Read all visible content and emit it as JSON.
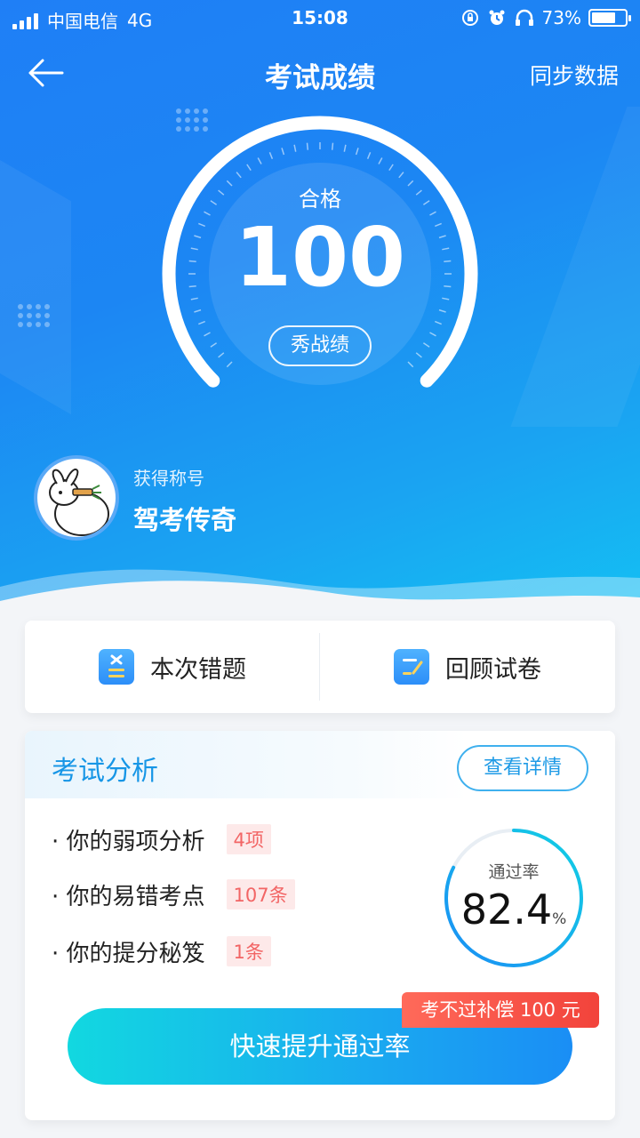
{
  "status_bar": {
    "carrier": "中国电信",
    "network": "4G",
    "time": "15:08",
    "battery": "73%",
    "battery_level": 0.73,
    "icons": [
      "signal-icon",
      "rotation-lock-icon",
      "alarm-icon",
      "headphones-icon",
      "battery-icon"
    ]
  },
  "nav": {
    "back_icon": "arrow-left-icon",
    "title": "考试成绩",
    "sync_label": "同步数据"
  },
  "score_gauge": {
    "status": "合格",
    "score": "100",
    "score_max": 100,
    "share_label": "秀战绩"
  },
  "honor": {
    "label": "获得称号",
    "name": "驾考传奇"
  },
  "actions": {
    "wrong_questions": "本次错题",
    "review_paper": "回顾试卷"
  },
  "analysis": {
    "title": "考试分析",
    "detail_label": "查看详情",
    "items": [
      {
        "label": "· 你的弱项分析",
        "tag": "4项"
      },
      {
        "label": "· 你的易错考点",
        "tag": "107条"
      },
      {
        "label": "· 你的提分秘笈",
        "tag": "1条"
      }
    ],
    "pass_rate_label": "通过率",
    "pass_rate_value": "82.4",
    "pass_rate_unit": "%",
    "pass_rate_fraction": 0.824,
    "boost_label": "快速提升通过率",
    "compensation_badge": "考不过补偿 100 元"
  },
  "colors": {
    "hero_gradient_start": "#1f7ff6",
    "hero_gradient_end": "#13c1f3",
    "accent_blue": "#1796e6",
    "tag_red": "#f26565",
    "badge_red": "#f2433b",
    "boost_cyan": "#12d8e0"
  }
}
